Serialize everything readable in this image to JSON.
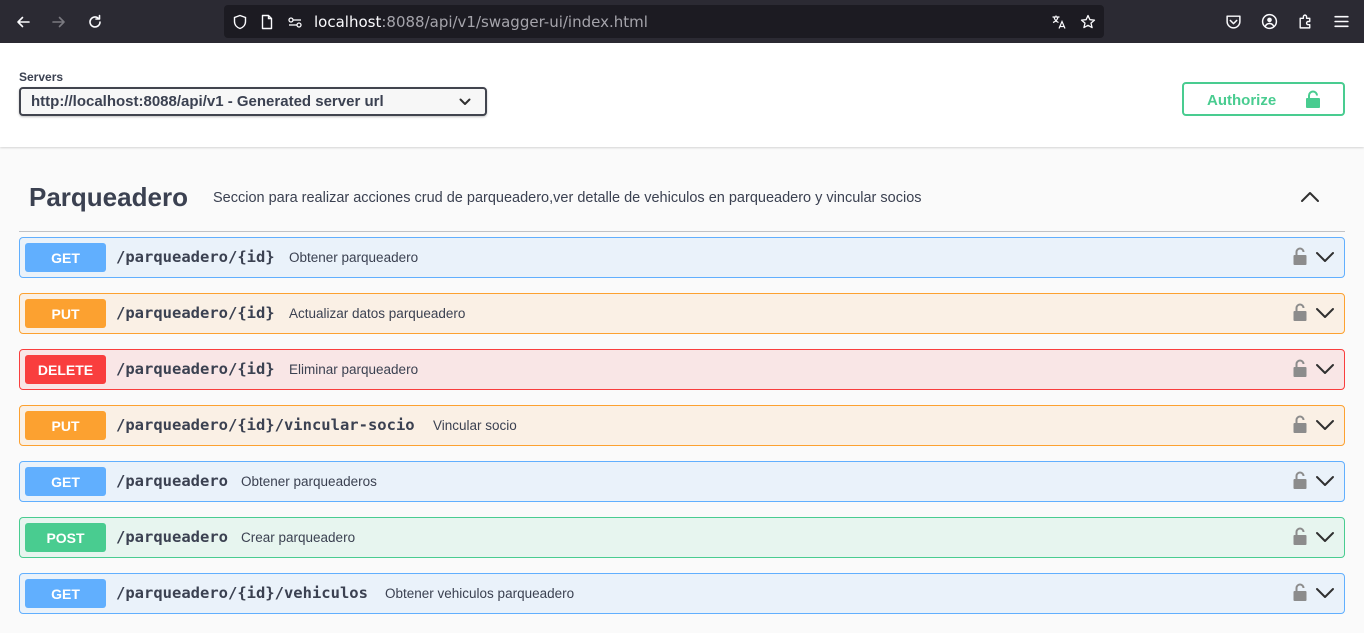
{
  "browser": {
    "url_host": "localhost",
    "url_rest": ":8088/api/v1/swagger-ui/index.html"
  },
  "servers": {
    "title": "Servers",
    "selected": "http://localhost:8088/api/v1 - Generated server url"
  },
  "authorize": {
    "label": "Authorize"
  },
  "tag": {
    "name": "Parqueadero",
    "description": "Seccion para realizar acciones crud de parqueadero,ver detalle de vehiculos en parqueadero y vincular socios"
  },
  "operations": [
    {
      "method": "GET",
      "path": "/parqueadero/{id}",
      "summary": "Obtener parqueadero"
    },
    {
      "method": "PUT",
      "path": "/parqueadero/{id}",
      "summary": "Actualizar datos parqueadero"
    },
    {
      "method": "DELETE",
      "path": "/parqueadero/{id}",
      "summary": "Eliminar parqueadero"
    },
    {
      "method": "PUT",
      "path": "/parqueadero/{id}/vincular-socio",
      "summary": "Vincular socio"
    },
    {
      "method": "GET",
      "path": "/parqueadero",
      "summary": "Obtener parqueaderos"
    },
    {
      "method": "POST",
      "path": "/parqueadero",
      "summary": "Crear parqueadero"
    },
    {
      "method": "GET",
      "path": "/parqueadero/{id}/vehiculos",
      "summary": "Obtener vehiculos parqueadero"
    }
  ],
  "colors": {
    "get": "#61affe",
    "put": "#fca130",
    "delete": "#f93e3e",
    "post": "#49cc90",
    "text": "#3b4151"
  }
}
